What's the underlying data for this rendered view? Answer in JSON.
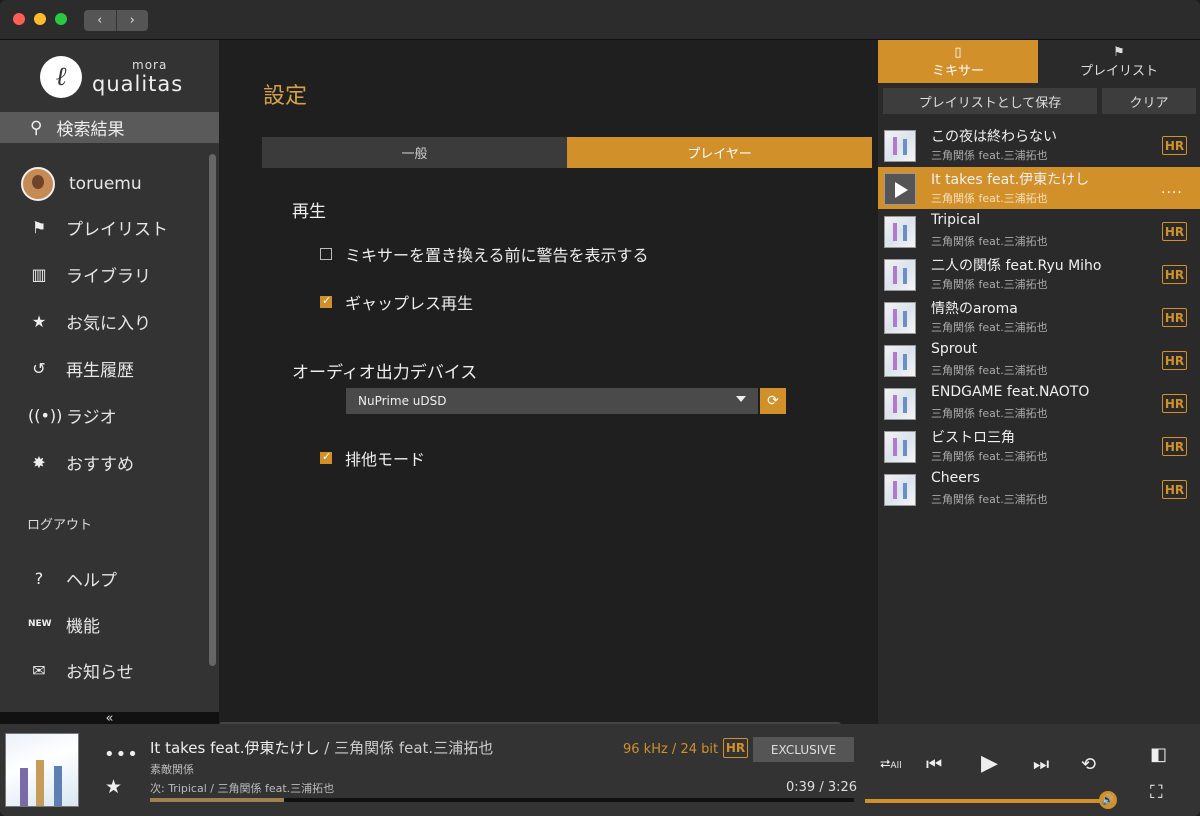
{
  "window": {
    "nav_back": "‹",
    "nav_forward": "›"
  },
  "sidebar": {
    "logo_top": "mora",
    "logo_name": "qualitas",
    "logo_mark": "ℓ",
    "search_label": "検索結果",
    "user": "toruemu",
    "items": [
      {
        "label": "プレイリスト",
        "icon": "playlist-icon"
      },
      {
        "label": "ライブラリ",
        "icon": "library-icon"
      },
      {
        "label": "お気に入り",
        "icon": "star-icon"
      },
      {
        "label": "再生履歴",
        "icon": "history-icon"
      },
      {
        "label": "ラジオ",
        "icon": "radio-icon"
      },
      {
        "label": "おすすめ",
        "icon": "recommend-icon"
      }
    ],
    "logout": "ログアウト",
    "bottom_items": [
      {
        "label": "ヘルプ",
        "icon": "help-icon"
      },
      {
        "label": "機能",
        "icon": "new-icon"
      },
      {
        "label": "お知らせ",
        "icon": "mail-icon"
      }
    ],
    "collapse": "«"
  },
  "main": {
    "title": "設定",
    "tabs": [
      {
        "label": "一般",
        "active": false
      },
      {
        "label": "プレイヤー",
        "active": true
      }
    ],
    "section_playback": "再生",
    "opt_warn": {
      "label": "ミキサーを置き換える前に警告を表示する",
      "checked": false
    },
    "opt_gapless": {
      "label": "ギャップレス再生",
      "checked": true
    },
    "section_audio": "オーディオ出力デバイス",
    "device": "NuPrime uDSD",
    "opt_exclusive": {
      "label": "排他モード",
      "checked": true
    }
  },
  "right_panel": {
    "tab_mixer": "ミキサー",
    "tab_playlist": "プレイリスト",
    "save_playlist": "プレイリストとして保存",
    "clear": "クリア",
    "tracks": [
      {
        "title": "この夜は終わらない",
        "artist": "三角関係 feat.三浦拓也",
        "badge": "HR",
        "playing": false
      },
      {
        "title": "It takes feat.伊東たけし",
        "artist": "三角関係 feat.三浦拓也",
        "badge": "....",
        "playing": true
      },
      {
        "title": "Tripical",
        "artist": "三角関係 feat.三浦拓也",
        "badge": "HR",
        "playing": false
      },
      {
        "title": "二人の関係 feat.Ryu Miho",
        "artist": "三角関係 feat.三浦拓也",
        "badge": "HR",
        "playing": false
      },
      {
        "title": "情熱のaroma",
        "artist": "三角関係 feat.三浦拓也",
        "badge": "HR",
        "playing": false
      },
      {
        "title": "Sprout",
        "artist": "三角関係 feat.三浦拓也",
        "badge": "HR",
        "playing": false
      },
      {
        "title": "ENDGAME feat.NAOTO",
        "artist": "三角関係 feat.三浦拓也",
        "badge": "HR",
        "playing": false
      },
      {
        "title": "ビストロ三角",
        "artist": "三角関係 feat.三浦拓也",
        "badge": "HR",
        "playing": false
      },
      {
        "title": "Cheers",
        "artist": "三角関係 feat.三浦拓也",
        "badge": "HR",
        "playing": false
      }
    ]
  },
  "player": {
    "more": "•••",
    "title": "It takes feat.伊東たけし",
    "artist": "/ 三角関係 feat.三浦拓也",
    "album": "素敵関係",
    "next": "次: Tripical / 三角関係 feat.三浦拓也",
    "format": "96 kHz / 24 bit",
    "hr": "HR",
    "exclusive": "EXCLUSIVE",
    "time": "0:39 / 3:26",
    "progress": 0.19,
    "volume": 0.98,
    "repeat_label": "All",
    "accent": "#d1902a"
  }
}
